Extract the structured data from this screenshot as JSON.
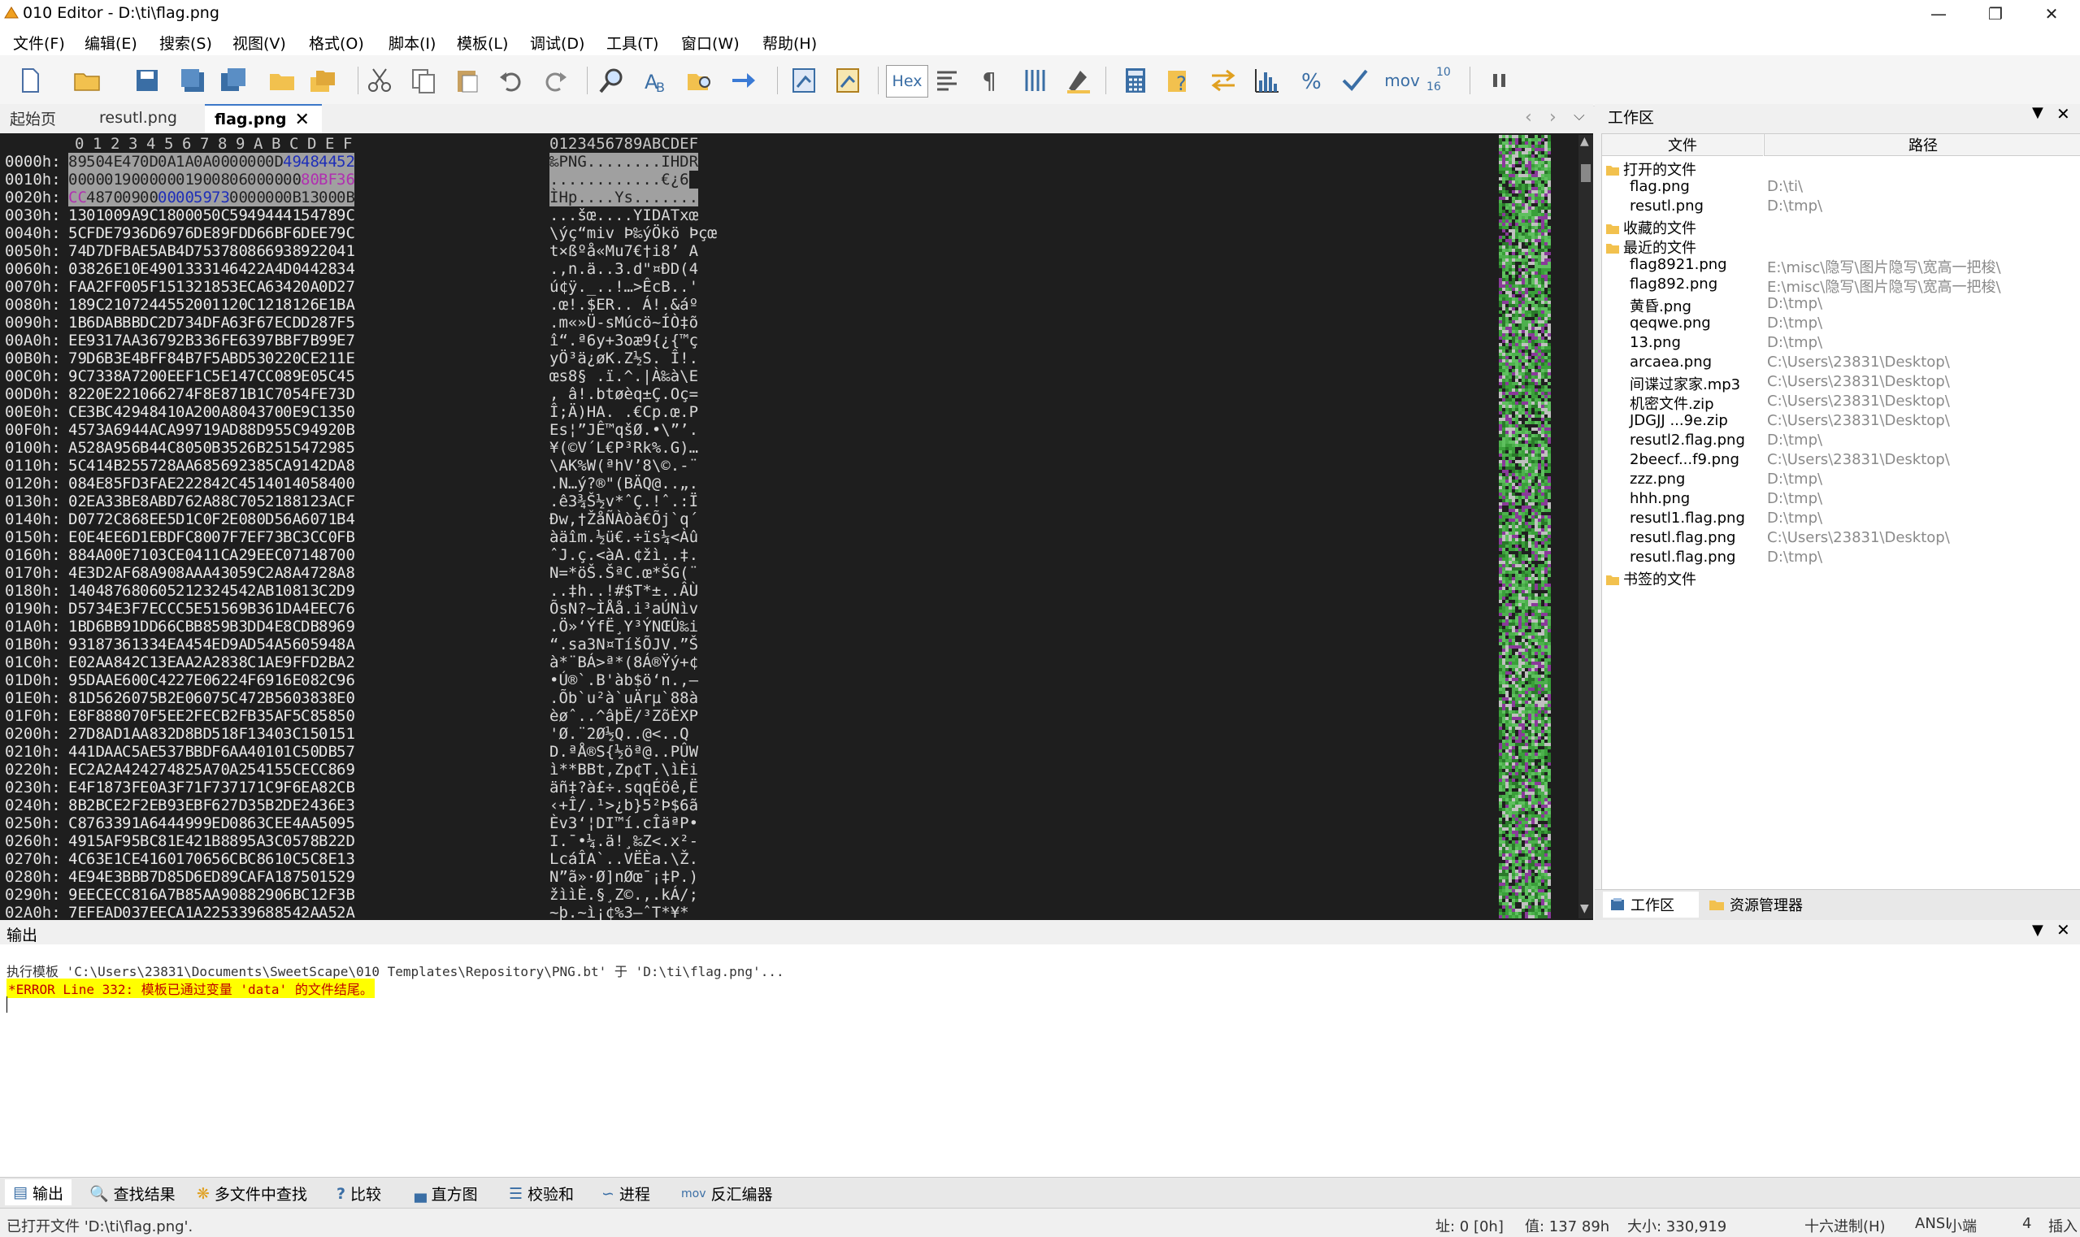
{
  "window": {
    "title": "010 Editor - D:\\ti\\flag.png"
  },
  "menu": [
    "文件(F)",
    "编辑(E)",
    "搜索(S)",
    "视图(V)",
    "格式(O)",
    "脚本(I)",
    "模板(L)",
    "调试(D)",
    "工具(T)",
    "窗口(W)",
    "帮助(H)"
  ],
  "toolbar": {
    "hex_label": "Hex",
    "mov_label": "mov",
    "num_label_top": "10",
    "num_label_bottom": "16"
  },
  "tabs": [
    "起始页",
    "resutl.png",
    "flag.png"
  ],
  "hex": {
    "col_header": [
      "0",
      "1",
      "2",
      "3",
      "4",
      "5",
      "6",
      "7",
      "8",
      "9",
      "A",
      "B",
      "C",
      "D",
      "E",
      "F"
    ],
    "ascii_header": "0123456789ABCDEF",
    "rows": [
      {
        "o": "0000h:",
        "h": "89 50 4E 47 0D 0A 1A 0A 00 00 00 0D 49 48 44 52",
        "a": "‰PNG........IHDR"
      },
      {
        "o": "0010h:",
        "h": "00 00 01 90 00 00 01 90 08 06 00 00 00 80 BF 36",
        "a": "............€¿6"
      },
      {
        "o": "0020h:",
        "h": "CC 48 70 09 00 00 00 59 73 00 00 00 0B 13 00 0B",
        "a": "ÌHp....Ys......."
      },
      {
        "o": "0030h:",
        "h": "13 01 00 9A 9C 18 00 05 0C 59 49 44 41 54 78 9C",
        "a": "...šœ....YIDATxœ"
      },
      {
        "o": "0040h:",
        "h": "5C FD E7 93 6D 69 76 DE 89 FD D6 6B F6 DE E7 9C",
        "a": "\\ýç“miv Þ‰ýÖkö Þçœ"
      },
      {
        "o": "0050h:",
        "h": "74 D7 DF BA E5 AB 4D 75 37 80 86 69 38 92 20 41",
        "a": "t×ßºå«Mu7€†i8’ A"
      },
      {
        "o": "0060h:",
        "h": "03 82 6E 10 E4 90 13 33 14 64 22 A4 D0 44 28 34",
        "a": ".‚n.ä..3.d\"¤ÐD(4"
      },
      {
        "o": "0070h:",
        "h": "FA A2 FF 00 5F 15 13 21 85 3E CA 63 42 0A 0D 27",
        "a": "ú¢ÿ._..!…>ÊcB..'"
      },
      {
        "o": "0080h:",
        "h": "18 9C 21 07 24 45 52 00 11 20 C1 21 81 26 E1 BA",
        "a": ".œ!.$ER.. Á!.&áº"
      },
      {
        "o": "0090h:",
        "h": "1B 6D AB BB DC 2D 73 4D FA 63 F6 7E CD D2 87 F5",
        "a": ".m«»Ü-sMúcö~ÍÒ‡õ"
      },
      {
        "o": "00A0h:",
        "h": "EE 93 17 AA 36 79 2B 33 6F E6 39 7B BF 7B 99 E7",
        "a": "î“.ª6y+3oæ9{¿{™ç"
      },
      {
        "o": "00B0h:",
        "h": "79 D6 B3 E4 BF F8 4B 7F 5A BD 53 02 20 CE 21 1E",
        "a": "yÖ³ä¿øK.Z½S. Î!."
      },
      {
        "o": "00C0h:",
        "h": "9C 73 38 A7 20 0E EF 1C 5E 14 7C C0 89 E0 5C 45",
        "a": "œs8§ .ï.^.|À‰à\\E"
      },
      {
        "o": "00D0h:",
        "h": "82 20 E2 21 06 62 74 F8 E8 71 B1 C7 05 4F E7 3D",
        "a": "‚ â!.btøèq±Ç.Oç="
      },
      {
        "o": "00E0h:",
        "h": "CE 3B C4 29 48 41 0A 20 0A 80 43 70 0E 9C 13 50",
        "a": "Î;Ä)HA. .€Cp.œ.P"
      },
      {
        "o": "00F0h:",
        "h": "45 73 A6 94 4A CA 99 71 9A D8 8D 95 5C 94 92 0B",
        "a": "Es¦”JÊ™qšØ.•\\”’."
      },
      {
        "o": "0100h:",
        "h": "A5 28 A9 56 B4 4C 80 50 B3 52 6B 25 15 47 29 85",
        "a": "¥(©V´L€P³Rk%.G)…"
      },
      {
        "o": "0110h:",
        "h": "5C 41 4B 25 57 28 AA 68 56 92 38 5C A9 14 2D A8",
        "a": "\\AK%W(ªhV’8\\©.-¨"
      },
      {
        "o": "0120h:",
        "h": "08 4E 85 FD 3F AE 22 28 42 C4 51 40 14 05 84 00",
        "a": ".N…ý?®\"(BÄQ@..„."
      },
      {
        "o": "0130h:",
        "h": "02 EA 33 BE 8A BD 76 2A 88 C7 05 21 88 12 3A CF",
        "a": ".ê3¾Š½v*ˆÇ.!ˆ.:Ï"
      },
      {
        "o": "0140h:",
        "h": "D0 77 2C 86 8E E5 D1 C0 F2 E0 80 D5 6A 60 71 B4",
        "a": "Ðw,†ŽåÑÀòà€Õj`q´"
      },
      {
        "o": "0150h:",
        "h": "E0 E4 EE 6D 1E BD FC 80 07 F7 EF 73 BC 3C C0 FB",
        "a": "àäîm.½ü€.÷ïs¼<Àû"
      },
      {
        "o": "0160h:",
        "h": "88 4A 00 E7 10 3C E0 41 1C A2 9E EC 07 14 87 00",
        "a": "ˆJ.ç.<àA.¢žì..‡."
      },
      {
        "o": "0170h:",
        "h": "4E 3D 2A F6 8A 90 8A AA 43 05 9C 2A 8A 47 28 A8",
        "a": "N=*öŠ.ŠªC.œ*ŠG(¨"
      },
      {
        "o": "0180h:",
        "h": "14 04 87 68 06 05 21 23 24 54 2A B1 08 13 C2 D9",
        "a": "..‡h..!#$T*±..ÂÙ"
      },
      {
        "o": "0190h:",
        "h": "D5 73 4E 3F 7E CC C5 E5 15 69 B3 61 DA 4E EC 76",
        "a": "ÕsN?~ÌÅå.i³aÚNìv"
      },
      {
        "o": "01A0h:",
        "h": "1B D6 BB 91 DD 66 CB B8 59 B3 DD 4E 8C DB 89 69",
        "a": ".Ö»‘ÝfË¸Y³ÝNŒÛ‰i"
      },
      {
        "o": "01B0h:",
        "h": "93 18 73 61 33 4E A4 54 ED 9A D5 4A 56 05 94 8A",
        "a": "“.sa3N¤TíšÕJV.”Š"
      },
      {
        "o": "01C0h:",
        "h": "E0 2A A8 42 C1 3E AA 2A 28 38 C1 AE 9F FD 2B A2",
        "a": "à*¨BÁ>ª*(8Á®Ÿý+¢"
      },
      {
        "o": "01D0h:",
        "h": "95 DA AE 60 0C 42 27 E0 62 24 F6 91 6E 08 2C 96",
        "a": "•Ú®`.B'àb$ö‘n.,–"
      },
      {
        "o": "01E0h:",
        "h": "81 D5 62 60 75 B2 E0 60 75 C4 72 B5 60 38 38 E0",
        "a": ".Õb`u²à`uÄrµ`88à"
      },
      {
        "o": "01F0h:",
        "h": "E8 F8 88 07 0F 5E E2 FE CB 2F B3 5A F5 C8 58 50",
        "a": "èøˆ..^âþË/³ZõÈXP"
      },
      {
        "o": "0200h:",
        "h": "27 D8 AD 1A A8 32 D8 BD 51 8F 13 40 3C 15 01 51",
        "a": "'Ø­.¨2Ø½Q..@<..Q"
      },
      {
        "o": "0210h:",
        "h": "44 1D AA C5 AE 53 7B BD F6 AA 40 10 1C 50 DB 57",
        "a": "D.ªÅ®S{½öª@..PÛW"
      },
      {
        "o": "0220h:",
        "h": "EC 2A 2A 42 42 74 82 5A 70 A2 54 15 5C EC C8 69",
        "a": "ì**BBt‚Zp¢T.\\ìÈi"
      },
      {
        "o": "0230h:",
        "h": "E4 F1 87 3F E0 A3 F7 1F 73 71 71 C9 F6 EA 82 CB",
        "a": "äñ‡?à£÷.sqqÉöê‚Ë"
      },
      {
        "o": "0240h:",
        "h": "8B 2B CE 2F 2E B9 3E BF 62 7D 35 B2 DE 24 36 E3",
        "a": "‹+Î/.¹>¿b}5²Þ$6ã"
      },
      {
        "o": "0250h:",
        "h": "C8 76 33 91 A6 44 49 99 ED 08 63 CE E4 AA 50 95",
        "a": "Èv3‘¦DI™í.cÎäªP•"
      },
      {
        "o": "0260h:",
        "h": "49 15 AF 95 BC 81 E4 21 B8 89 5A 3C 05 78 B2 2D",
        "a": "I.¯•¼.ä!¸‰Z<.x²-"
      },
      {
        "o": "0270h:",
        "h": "4C 63 E1 CE 41 60 17 06 56 CB C8 61 0C 5C 8E 13",
        "a": "LcáÎA`..VËÈa.\\Ž."
      },
      {
        "o": "0280h:",
        "h": "4E 94 E3 BB B7 D8 5D 6E D8 9C AF A1 87 50 15 29",
        "a": "N”ã»·Ø]nØœ¯¡‡P.)"
      },
      {
        "o": "0290h:",
        "h": "9E EC EC C8 16 A7 B8 5A A9 08 82 90 6B C1 2F 3B",
        "a": "žììÈ.§¸Z©.‚.kÁ/;"
      },
      {
        "o": "02A0h:",
        "h": "7E FE AD 03 7E EC A1 A2 25 33 96 88 54 2A A5 2A",
        "a": "~þ­.~ì¡¢%3–ˆT*¥*"
      }
    ]
  },
  "workspace": {
    "title": "工作区",
    "col_file": "文件",
    "col_path": "路径",
    "groups": {
      "open": "打开的文件",
      "fav": "收藏的文件",
      "recent": "最近的文件",
      "bookmarks": "书签的文件"
    },
    "open_files": [
      {
        "name": "flag.png",
        "path": "D:\\ti\\"
      },
      {
        "name": "resutl.png",
        "path": "D:\\tmp\\"
      }
    ],
    "recent_files": [
      {
        "name": "flag8921.png",
        "path": "E:\\misc\\隐写\\图片隐写\\宽高一把梭\\"
      },
      {
        "name": "flag892.png",
        "path": "E:\\misc\\隐写\\图片隐写\\宽高一把梭\\"
      },
      {
        "name": "黄昏.png",
        "path": "D:\\tmp\\"
      },
      {
        "name": "qeqwe.png",
        "path": "D:\\tmp\\"
      },
      {
        "name": "13.png",
        "path": "D:\\tmp\\"
      },
      {
        "name": "arcaea.png",
        "path": "C:\\Users\\23831\\Desktop\\"
      },
      {
        "name": "间谍过家家.mp3",
        "path": "C:\\Users\\23831\\Desktop\\"
      },
      {
        "name": "机密文件.zip",
        "path": "C:\\Users\\23831\\Desktop\\"
      },
      {
        "name": "JDGJJ ...9e.zip",
        "path": "C:\\Users\\23831\\Desktop\\"
      },
      {
        "name": "resutl2.flag.png",
        "path": "D:\\tmp\\"
      },
      {
        "name": "2beecf...f9.png",
        "path": "C:\\Users\\23831\\Desktop\\"
      },
      {
        "name": "zzz.png",
        "path": "D:\\tmp\\"
      },
      {
        "name": "hhh.png",
        "path": "D:\\tmp\\"
      },
      {
        "name": "resutl1.flag.png",
        "path": "D:\\tmp\\"
      },
      {
        "name": "resutl.flag.png",
        "path": "C:\\Users\\23831\\Desktop\\"
      },
      {
        "name": "resutl.flag.png",
        "path": "D:\\tmp\\"
      }
    ],
    "tab_workspace": "工作区",
    "tab_explorer": "资源管理器"
  },
  "output": {
    "title": "输出",
    "line1": "执行模板 'C:\\Users\\23831\\Documents\\SweetScape\\010 Templates\\Repository\\PNG.bt' 于 'D:\\ti\\flag.png'...",
    "error": "*ERROR Line 332: 模板已通过变量 'data' 的文件结尾。"
  },
  "bottom_tabs": [
    "输出",
    "查找结果",
    "多文件中查找",
    "比较",
    "直方图",
    "校验和",
    "进程",
    "反汇编器"
  ],
  "status": {
    "left": "已打开文件 'D:\\ti\\flag.png'.",
    "address": "址: 0 [0h]",
    "value": "值: 137 89h",
    "size": "大小: 330,919",
    "mode": "十六进制(H)",
    "encoding": "ANSI",
    "endian": "小端",
    "col": "4",
    "insert": "插入"
  },
  "colors": {
    "editor_bg": "#1e1e1e",
    "highlight_gray": "#a0a0a0",
    "blue_text": "#1f2fb8",
    "purple_text": "#b030b0",
    "error_bg": "#ffff00",
    "active_tab_border": "#3c78c8"
  }
}
